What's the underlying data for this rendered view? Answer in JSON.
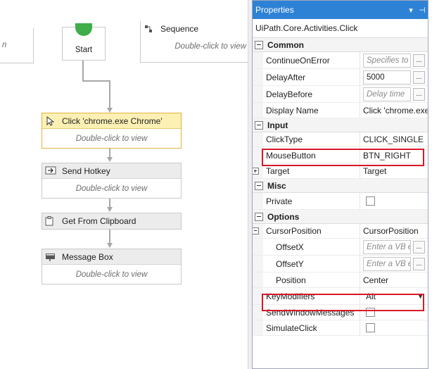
{
  "designer": {
    "top_left_hint": "n",
    "sequence_title": "Sequence",
    "sequence_hint": "Double-click to view",
    "start_label": "Start",
    "activities": [
      {
        "title": "Click 'chrome.exe Chrome'",
        "hint": "Double-click to view"
      },
      {
        "title": "Send Hotkey",
        "hint": "Double-click to view"
      },
      {
        "title": "Get From Clipboard"
      },
      {
        "title": "Message Box",
        "hint": "Double-click to view"
      }
    ]
  },
  "properties": {
    "panel_title": "Properties",
    "pin_glyph": "▾",
    "pin2_glyph": "⊣",
    "activity_type": "UiPath.Core.Activities.Click",
    "ellipsis": "...",
    "categories": {
      "common": "Common",
      "input": "Input",
      "misc": "Misc",
      "options": "Options"
    },
    "rows": {
      "continue_on_error": {
        "name": "ContinueOnError",
        "placeholder": "Specifies to"
      },
      "delay_after": {
        "name": "DelayAfter",
        "value": "5000"
      },
      "delay_before": {
        "name": "DelayBefore",
        "placeholder": "Delay time"
      },
      "display_name": {
        "name": "Display Name",
        "value": "Click 'chrome.exe"
      },
      "click_type": {
        "name": "ClickType",
        "value": "CLICK_SINGLE"
      },
      "mouse_button": {
        "name": "MouseButton",
        "value": "BTN_RIGHT"
      },
      "target": {
        "name": "Target",
        "value": "Target"
      },
      "private": {
        "name": "Private"
      },
      "cursor_position": {
        "name": "CursorPosition",
        "value": "CursorPosition"
      },
      "offset_x": {
        "name": "OffsetX",
        "placeholder": "Enter a VB e"
      },
      "offset_y": {
        "name": "OffsetY",
        "placeholder": "Enter a VB e"
      },
      "position": {
        "name": "Position",
        "value": "Center"
      },
      "key_modifiers": {
        "name": "KeyModifiers",
        "value": "Alt"
      },
      "send_window_messages": {
        "name": "SendWindowMessages"
      },
      "simulate_click": {
        "name": "SimulateClick"
      }
    }
  },
  "colors": {
    "accent": "#2e82d6",
    "highlight": "#d8182a",
    "selected_activity": "#fdf0b4",
    "start_green": "#3fae49"
  }
}
